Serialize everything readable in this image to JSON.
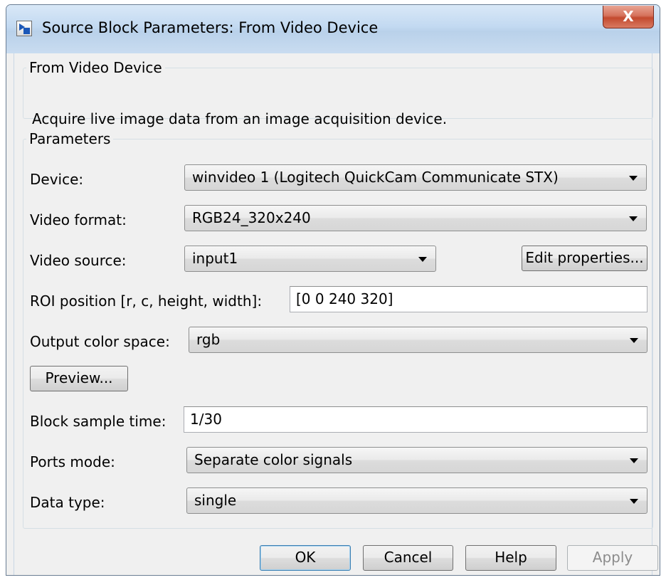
{
  "window": {
    "title": "Source Block Parameters: From Video Device",
    "app_icon": "simulink-block-icon",
    "close_label": "X"
  },
  "description_group": {
    "legend": "From Video Device",
    "text": "Acquire live image data from an image acquisition device."
  },
  "parameters": {
    "legend": "Parameters",
    "device": {
      "label": "Device:",
      "value": "winvideo 1 (Logitech QuickCam Communicate STX)"
    },
    "video_format": {
      "label": "Video format:",
      "value": "RGB24_320x240"
    },
    "video_source": {
      "label": "Video source:",
      "value": "input1"
    },
    "edit_properties": "Edit properties...",
    "roi_position": {
      "label": "ROI position [r, c, height, width]:",
      "value": "[0 0 240 320]"
    },
    "output_color_space": {
      "label": "Output color space:",
      "value": "rgb"
    },
    "preview": "Preview...",
    "block_sample_time": {
      "label": "Block sample time:",
      "value": "1/30"
    },
    "ports_mode": {
      "label": "Ports mode:",
      "value": "Separate color signals"
    },
    "data_type": {
      "label": "Data type:",
      "value": "single"
    }
  },
  "buttons": {
    "ok": "OK",
    "cancel": "Cancel",
    "help": "Help",
    "apply": "Apply"
  },
  "colors": {
    "titlebar": "#c2d9f1",
    "close_button": "#c34a2f",
    "default_button_border": "#3c7fb1"
  }
}
